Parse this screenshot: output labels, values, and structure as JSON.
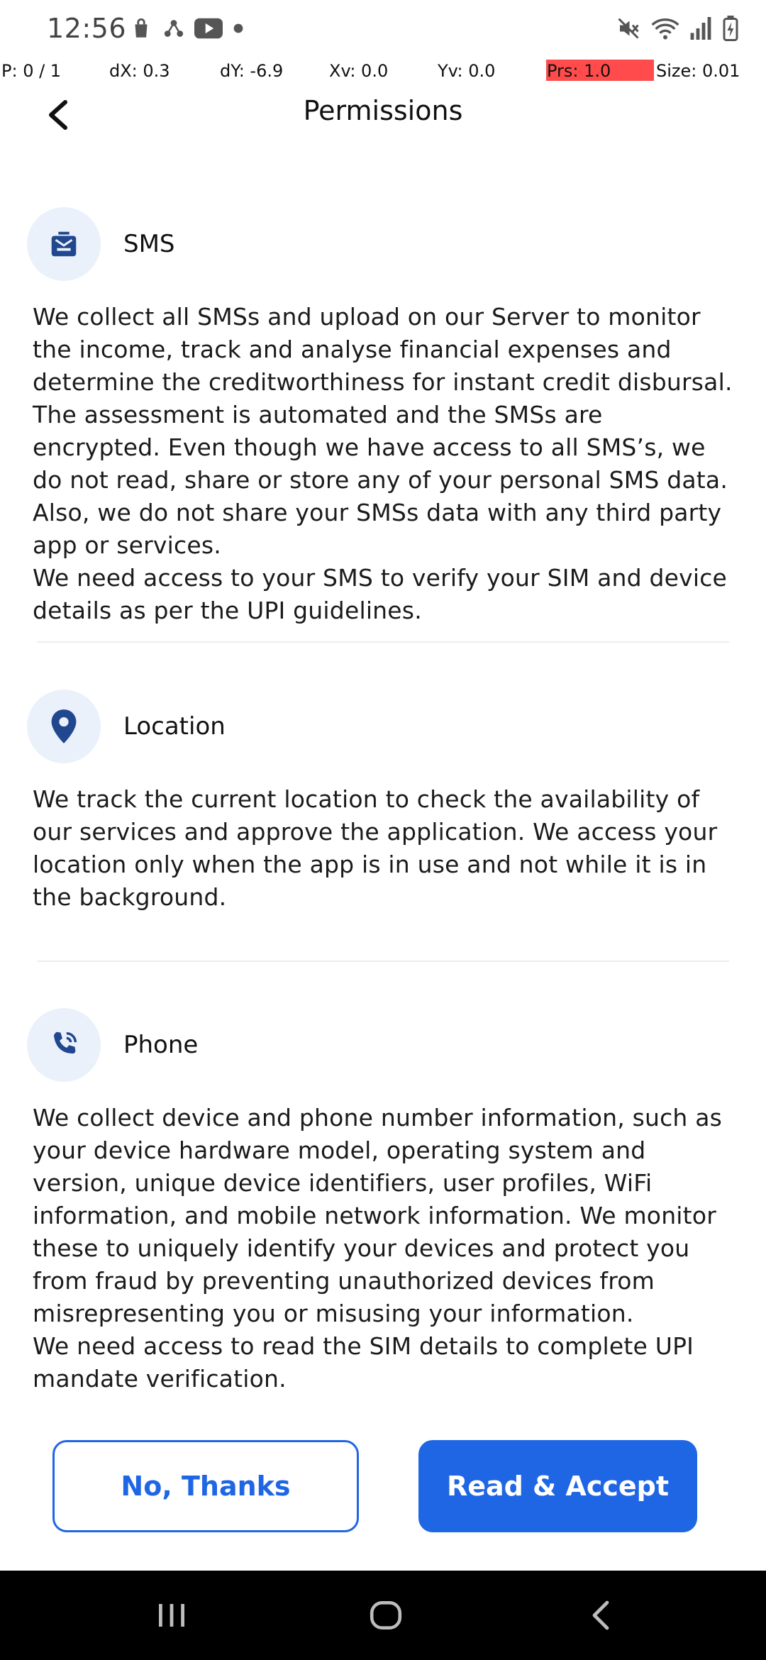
{
  "status_bar": {
    "time": "12:56",
    "left_icons": [
      "shopping-bag-icon",
      "nodes-icon",
      "youtube-icon",
      "dot-icon"
    ],
    "right_icons": [
      "mute-icon",
      "wifi-icon",
      "signal-icon",
      "battery-icon"
    ]
  },
  "pointer_overlay": {
    "p": "P: 0 / 1",
    "dx": "dX: 0.3",
    "dy": "dY: -6.9",
    "xv": "Xv: 0.0",
    "yv": "Yv: 0.0",
    "prs": "Prs: 1.0",
    "size": "Size: 0.01",
    "prs_highlight_color": "#ff4b4b"
  },
  "header": {
    "title": "Permissions",
    "back_icon": "chevron-left-icon"
  },
  "sections": [
    {
      "icon": "sms-envelope-icon",
      "title": "SMS",
      "body": "We collect all SMSs and upload on our Server to monitor the income, track and analyse financial expenses and determine the creditworthiness for instant credit disbursal. The assessment is automated and the SMSs are encrypted. Even though we have access to all SMS’s, we do not read, share or store any of your personal SMS data. Also, we do not share your SMSs data with any third party app or services.\nWe need access to your SMS to verify your SIM and device details as per the UPI guidelines."
    },
    {
      "icon": "location-pin-icon",
      "title": "Location",
      "body": "We track the current location to check the availability of our services and approve the application. We access your location only when the app is in use and not while it is in the background."
    },
    {
      "icon": "phone-call-icon",
      "title": "Phone",
      "body": "We collect device and phone number information, such as your device hardware model, operating system and version, unique device identifiers, user profiles, WiFi information, and mobile network information. We monitor these to uniquely identify your devices and protect you from fraud by preventing unauthorized devices from misrepresenting you or misusing your information.\nWe need access to read the SIM details to complete UPI mandate verification."
    }
  ],
  "actions": {
    "decline_label": "No, Thanks",
    "accept_label": "Read & Accept",
    "accent_color": "#1f66e5"
  },
  "nav_bar": {
    "items": [
      "recent-apps-icon",
      "home-icon",
      "back-icon"
    ]
  }
}
